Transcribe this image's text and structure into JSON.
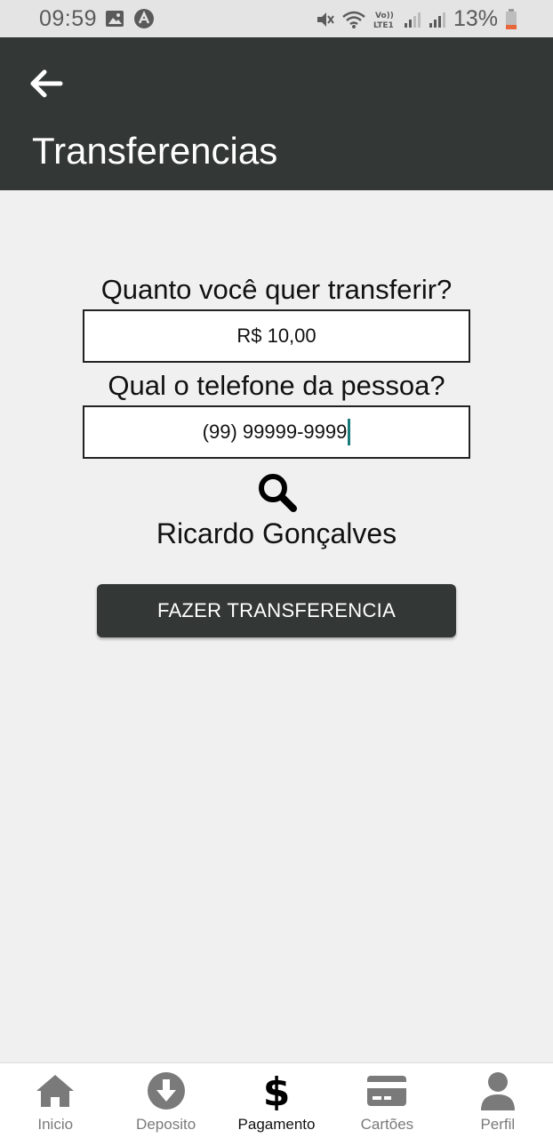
{
  "status_bar": {
    "time": "09:59",
    "battery": "13%",
    "battery_color": "#e8663a"
  },
  "app_bar": {
    "title": "Transferencias",
    "back_icon": "arrow-left-icon"
  },
  "form": {
    "amount_label": "Quanto você quer transferir?",
    "amount_value": "R$ 10,00",
    "phone_label": "Qual o telefone da pessoa?",
    "phone_value": "(99) 99999-9999",
    "search_icon": "search-icon",
    "recipient_name": "Ricardo Gonçalves",
    "submit_label": "FAZER TRANSFERENCIA"
  },
  "bottom_nav": {
    "items": [
      {
        "label": "Inicio",
        "icon": "home-icon"
      },
      {
        "label": "Deposito",
        "icon": "download-circle-icon"
      },
      {
        "label": "Pagamento",
        "icon": "dollar-icon",
        "active": true
      },
      {
        "label": "Cartões",
        "icon": "credit-card-icon"
      },
      {
        "label": "Perfil",
        "icon": "user-icon"
      }
    ]
  },
  "colors": {
    "app_bar": "#333837",
    "background": "#f0f0f0",
    "nav_inactive": "#7a7a7a",
    "caret": "#1a7a7a"
  }
}
